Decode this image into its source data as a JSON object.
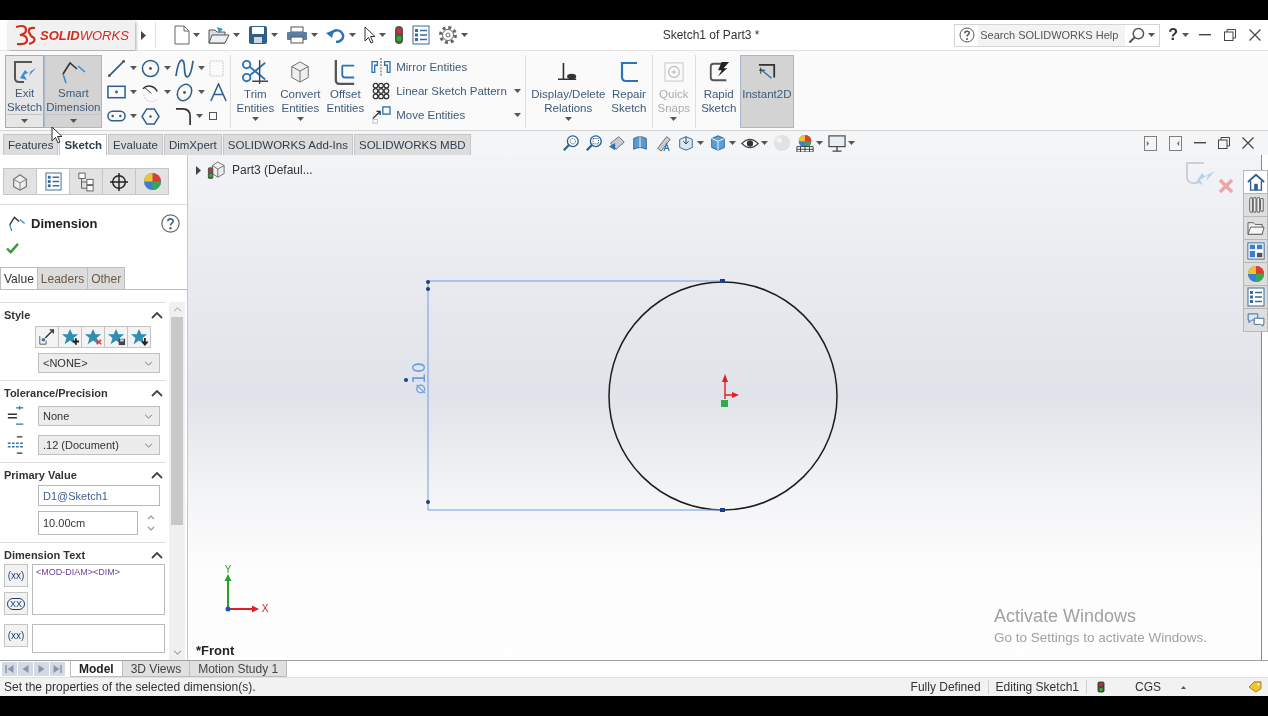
{
  "window": {
    "title": "Sketch1 of Part3 *"
  },
  "logo": {
    "text": "**SOLID**WORKS"
  },
  "help_search": {
    "placeholder": "Search SOLIDWORKS Help"
  },
  "help_button": {
    "label": "?"
  },
  "ribbon": {
    "sketch_buttons": [
      {
        "label": "Exit Sketch",
        "hovered": true,
        "selected": false
      },
      {
        "label": "Smart Dimension",
        "hovered": false,
        "selected": true
      }
    ],
    "entity_tools": [
      {
        "label": "Trim Entities",
        "dropdown": true
      },
      {
        "label": "Convert Entities",
        "dropdown": true
      },
      {
        "label": "Offset Entities",
        "dropdown": false
      }
    ],
    "entity_commands": [
      {
        "label": "Mirror Entities",
        "dropdown": false
      },
      {
        "label": "Linear Sketch Pattern",
        "dropdown": true
      },
      {
        "label": "Move Entities",
        "dropdown": true
      }
    ],
    "sketch_tools": [
      {
        "label": "Display/Delete Relations",
        "dropdown": true,
        "disabled": false,
        "selected": false
      },
      {
        "label": "Repair Sketch",
        "dropdown": false,
        "disabled": false,
        "selected": false
      },
      {
        "label": "Quick Snaps",
        "dropdown": true,
        "disabled": true,
        "selected": false
      },
      {
        "label": "Rapid Sketch",
        "dropdown": false,
        "disabled": false,
        "selected": false
      },
      {
        "label": "Instant2D",
        "dropdown": false,
        "disabled": false,
        "selected": true
      }
    ]
  },
  "command_tabs": [
    {
      "label": "Features",
      "selected": false
    },
    {
      "label": "Sketch",
      "selected": true
    },
    {
      "label": "Evaluate",
      "selected": false
    },
    {
      "label": "DimXpert",
      "selected": false
    },
    {
      "label": "SOLIDWORKS Add-Ins",
      "selected": false
    },
    {
      "label": "SOLIDWORKS MBD",
      "selected": false
    }
  ],
  "property_manager": {
    "manager_tabs": [
      {
        "selected": false
      },
      {
        "selected": true
      },
      {
        "selected": false
      },
      {
        "selected": false
      },
      {
        "selected": false
      }
    ],
    "title": "Dimension",
    "tabs": [
      {
        "label": "Value",
        "selected": true
      },
      {
        "label": "Leaders",
        "selected": false
      },
      {
        "label": "Other",
        "selected": false
      }
    ],
    "sections": [
      {
        "kind": "style",
        "title": "Style",
        "expanded": true,
        "style_value": "<NONE>"
      },
      {
        "kind": "tolerance",
        "title": "Tolerance/Precision",
        "expanded": true,
        "tolerance": "None",
        "precision": ".12 (Document)"
      },
      {
        "kind": "primary_value",
        "title": "Primary Value",
        "expanded": true,
        "name": "D1@Sketch1",
        "value": "10.00cm"
      },
      {
        "kind": "dimension_text",
        "title": "Dimension Text",
        "expanded": true,
        "buttons": [
          {
            "kind": "parentheses",
            "label": "(xx)"
          },
          {
            "kind": "inspection",
            "label": "XX"
          },
          {
            "kind": "parentheses",
            "label": "(xx)"
          }
        ],
        "text_value": "<MOD-DIAM><DIM>"
      }
    ]
  },
  "graphics_area": {
    "tree": {
      "label": "Part3 (Defaul...",
      "expanded": false
    },
    "sketch": {
      "dimension_text": "⌀10",
      "dimension_selected": true
    },
    "triad": {
      "x_label": "X",
      "y_label": "Y"
    },
    "view_name": "*Front",
    "os_notice": {
      "title": "Activate Windows",
      "message": "Go to Settings to activate Windows."
    }
  },
  "task_pane": {
    "tabs": [
      {
        "selected": true
      },
      {
        "selected": false
      },
      {
        "selected": false
      },
      {
        "selected": false
      },
      {
        "selected": false
      },
      {
        "selected": false
      },
      {
        "selected": false
      }
    ]
  },
  "bottom_tabs": [
    {
      "label": "Model",
      "selected": true
    },
    {
      "label": "3D Views",
      "selected": false
    },
    {
      "label": "Motion Study 1",
      "selected": false
    }
  ],
  "status_bar": {
    "message": "Set the properties of the selected dimension(s).",
    "definition": "Fully Defined",
    "mode": "Editing Sketch1",
    "units": "CGS"
  }
}
